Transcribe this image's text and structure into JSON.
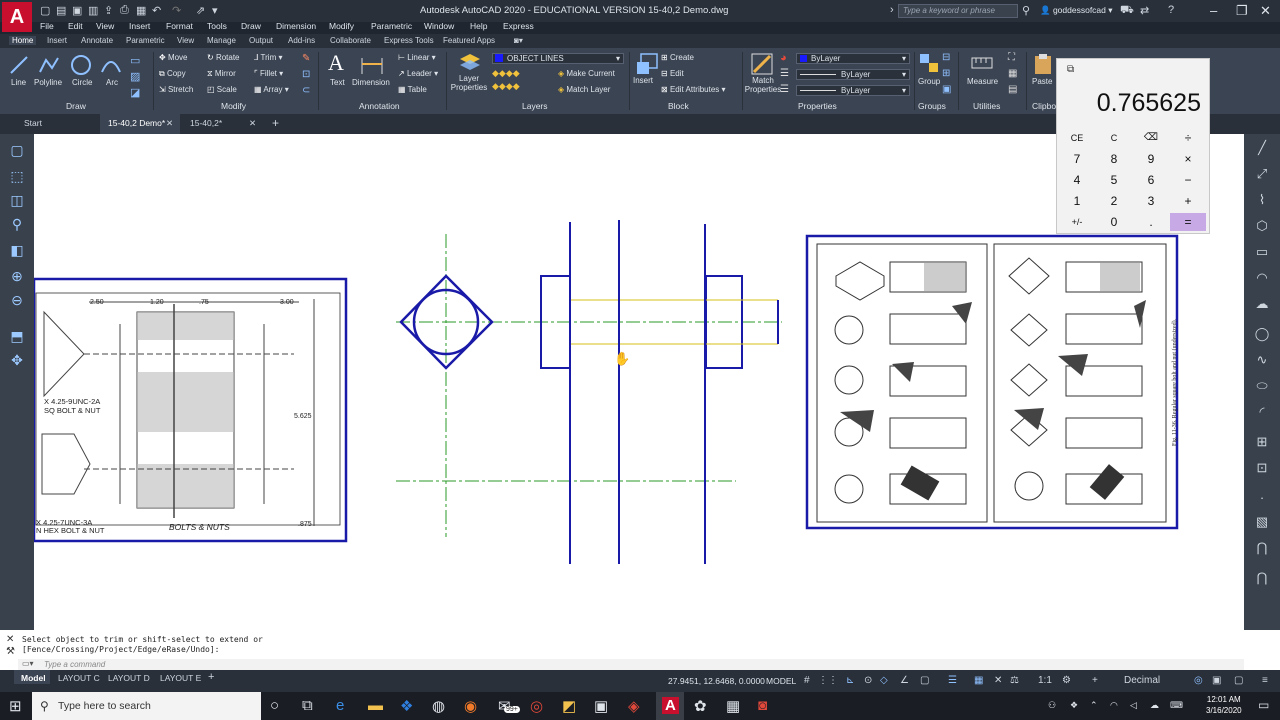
{
  "app": {
    "logo_letter": "A",
    "title": "Autodesk AutoCAD 2020 - EDUCATIONAL VERSION    15-40,2 Demo.dwg",
    "search_placeholder": "Type a keyword or phrase",
    "user": "goddessofcad"
  },
  "menu": [
    "File",
    "Edit",
    "View",
    "Insert",
    "Format",
    "Tools",
    "Draw",
    "Dimension",
    "Modify",
    "Parametric",
    "Window",
    "Help",
    "Express"
  ],
  "ribbon_tabs": [
    "Home",
    "Insert",
    "Annotate",
    "Parametric",
    "View",
    "Manage",
    "Output",
    "Add-ins",
    "Collaborate",
    "Express Tools",
    "Featured Apps"
  ],
  "ribbon": {
    "draw": {
      "title": "Draw",
      "line": "Line",
      "polyline": "Polyline",
      "circle": "Circle",
      "arc": "Arc"
    },
    "modify": {
      "title": "Modify",
      "move": "Move",
      "rotate": "Rotate",
      "trim": "Trim",
      "copy": "Copy",
      "mirror": "Mirror",
      "fillet": "Fillet",
      "stretch": "Stretch",
      "scale": "Scale",
      "array": "Array"
    },
    "annotation": {
      "title": "Annotation",
      "text": "Text",
      "dimension": "Dimension",
      "linear": "Linear",
      "leader": "Leader",
      "table": "Table"
    },
    "layers": {
      "title": "Layers",
      "layer_properties": "Layer Properties",
      "layer_combo": "OBJECT LINES",
      "make_current": "Make Current",
      "match_layer": "Match Layer"
    },
    "block": {
      "title": "Block",
      "insert": "Insert",
      "create": "Create",
      "edit": "Edit",
      "edit_attributes": "Edit Attributes"
    },
    "properties": {
      "title": "Properties",
      "match_properties": "Match Properties",
      "color": "ByLayer",
      "linetype": "ByLayer",
      "lineweight": "ByLayer"
    },
    "groups": {
      "title": "Groups",
      "group": "Group"
    },
    "utilities": {
      "title": "Utilities",
      "measure": "Measure"
    },
    "clipboard": {
      "title": "Clipbo",
      "paste": "Paste"
    }
  },
  "doc_tabs": [
    "Start",
    "15-40,2 Demo*",
    "15-40,2*"
  ],
  "drawing": {
    "left_sheet": {
      "dim1": "2.50",
      "dim2": "1.20",
      "dim3": ".75",
      "dim4": "3.00",
      "dim5": "5.625",
      "dim6": ".875",
      "note1_line1": "X 4.25-9UNC-2A",
      "note1_line2": "SQ BOLT & NUT",
      "note2_line1": "X 4.25-7UNC-3A",
      "note2_line2": "N HEX BOLT & NUT",
      "caption": "BOLTS & NUTS"
    },
    "right_sheet": {
      "fig_caption": "Fig. 11-36. Regular square bolt and nut (undersized)."
    }
  },
  "calculator": {
    "display": "0.765625",
    "keys": [
      [
        "CE",
        "C",
        "⌫",
        "÷"
      ],
      [
        "7",
        "8",
        "9",
        "×"
      ],
      [
        "4",
        "5",
        "6",
        "−"
      ],
      [
        "1",
        "2",
        "3",
        "+"
      ],
      [
        "+/-",
        "0",
        ".",
        "="
      ]
    ]
  },
  "command": {
    "history_line1": "Select object to trim or shift-select to extend or",
    "history_line2": "[Fence/Crossing/Project/Edge/eRase/Undo]:",
    "placeholder": "Type a command"
  },
  "layout_tabs": [
    "Model",
    "LAYOUT C",
    "LAYOUT D",
    "LAYOUT E"
  ],
  "status": {
    "coords": "27.9451, 12.6468, 0.0000",
    "model": "MODEL",
    "scale": "1:1",
    "units": "Decimal"
  },
  "taskbar": {
    "search": "Type here to search",
    "time": "12:01 AM",
    "date": "3/16/2020",
    "badge": "99+"
  },
  "colors": {
    "blue": "#1a1aa8",
    "green": "#2a9a2a",
    "yellow": "#d6c11a",
    "accent": "#c7a9e6"
  }
}
